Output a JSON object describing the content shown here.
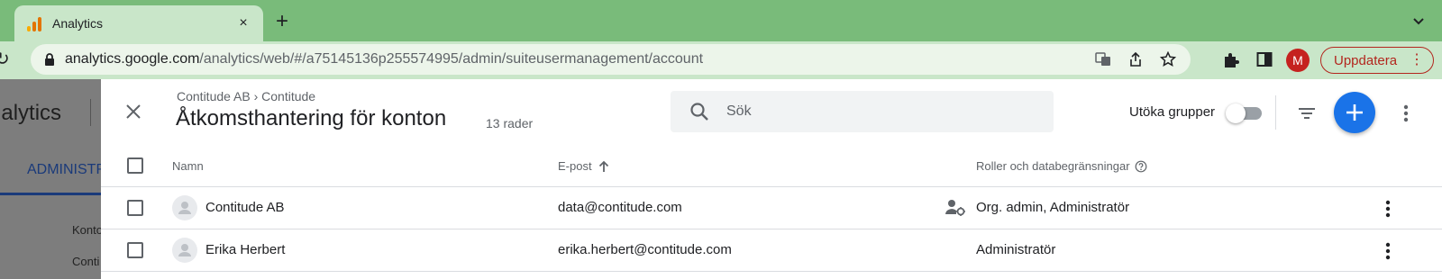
{
  "browser": {
    "tab_title": "Analytics",
    "tab_close": "×",
    "new_tab": "+",
    "url_host": "analytics.google.com",
    "url_path": "/analytics/web/#/a75145136p255574995/admin/suiteusermanagement/account",
    "profile_initial": "M",
    "update_label": "Uppdatera",
    "update_menu": "⋮",
    "reload": "↻"
  },
  "background": {
    "logo_text": "nalytics",
    "admin_tab": "ADMINISTR",
    "item1": "Konto",
    "item2": "Conti"
  },
  "drawer": {
    "breadcrumb": "Contitude AB › Contitude",
    "title": "Åtkomsthantering för konton",
    "row_count": "13 rader",
    "search_placeholder": "Sök",
    "expand_groups_label": "Utöka grupper",
    "expand_groups_on": false
  },
  "table": {
    "headers": {
      "name": "Namn",
      "email": "E-post",
      "roles": "Roller och databegränsningar"
    },
    "rows": [
      {
        "name": "Contitude AB",
        "email": "data@contitude.com",
        "roles": "Org. admin, Administratör",
        "has_role_icon": true
      },
      {
        "name": "Erika Herbert",
        "email": "erika.herbert@contitude.com",
        "roles": "Administratör",
        "has_role_icon": false
      }
    ]
  },
  "colors": {
    "tabstrip": "#79bb7a",
    "toolbar": "#c9e6c9",
    "accent": "#1a73e8",
    "update": "#b3261e",
    "profile": "#c5221f"
  }
}
